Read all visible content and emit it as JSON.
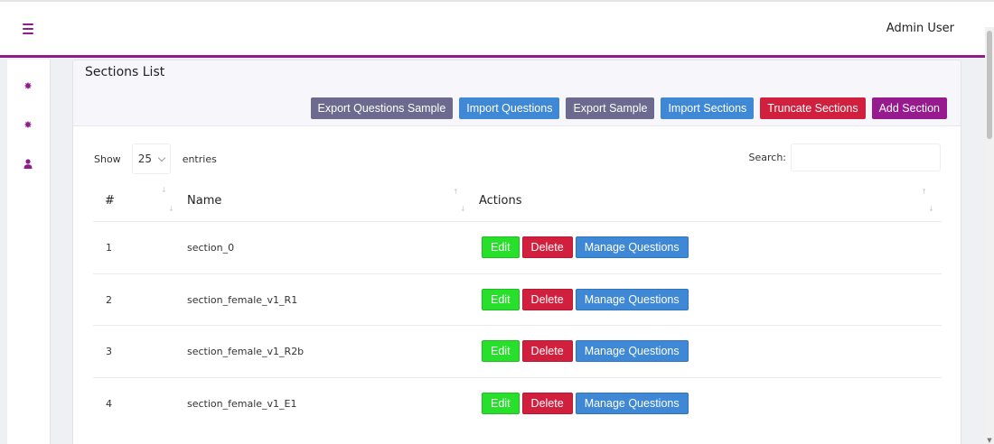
{
  "header": {
    "menu_icon": "hamburger-icon",
    "user_name": "Admin User"
  },
  "sidebar": {
    "items": [
      {
        "icon": "gear-icon"
      },
      {
        "icon": "gear-icon"
      },
      {
        "icon": "user-icon"
      }
    ]
  },
  "card": {
    "title": "Sections List",
    "toolbar": {
      "export_questions_sample": "Export Questions Sample",
      "import_questions": "Import Questions",
      "export_sample": "Export Sample",
      "import_sections": "Import Sections",
      "truncate_sections": "Truncate Sections",
      "add_section": "Add Section"
    }
  },
  "table_controls": {
    "show_label": "Show",
    "entries_value": "25",
    "entries_label": "entries",
    "search_label": "Search:",
    "search_value": ""
  },
  "table": {
    "headers": [
      "#",
      "Name",
      "Actions"
    ],
    "rows": [
      {
        "num": "1",
        "name": "section_0"
      },
      {
        "num": "2",
        "name": "section_female_v1_R1"
      },
      {
        "num": "3",
        "name": "section_female_v1_R2b"
      },
      {
        "num": "4",
        "name": "section_female_v1_E1"
      }
    ],
    "actions": {
      "edit": "Edit",
      "delete": "Delete",
      "manage": "Manage Questions"
    }
  },
  "colors": {
    "brand_purple": "#8e1d8a",
    "edit_green": "#28e02c",
    "danger_red": "#d0203e",
    "primary_blue": "#3f88d6",
    "secondary_gray": "#6d6a90"
  }
}
